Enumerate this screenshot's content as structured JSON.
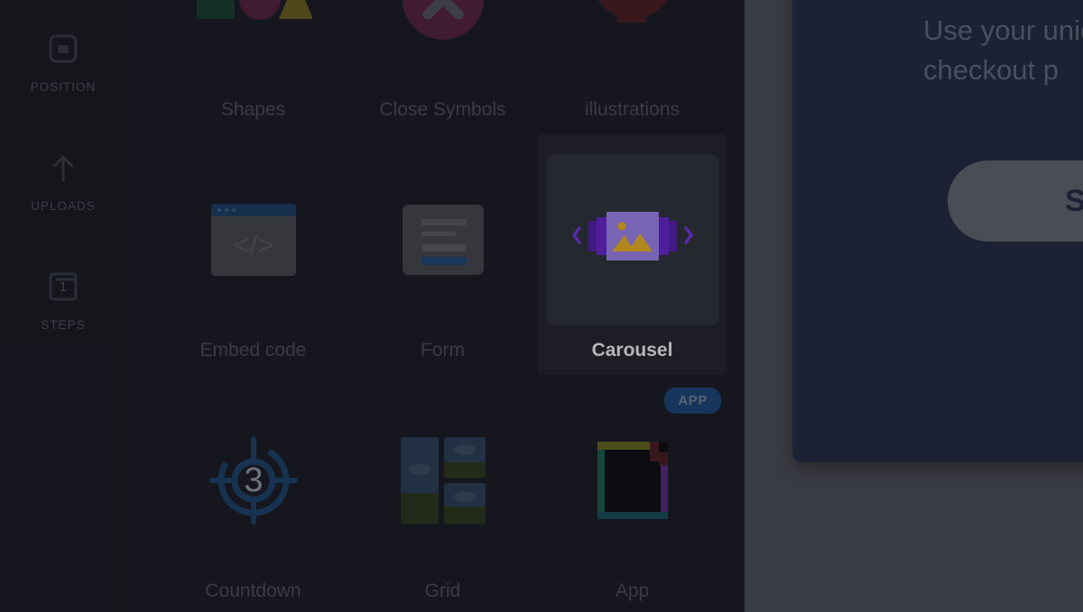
{
  "sidebar": {
    "items": [
      {
        "label": "POSITION",
        "icon": "position-icon"
      },
      {
        "label": "UPLOADS",
        "icon": "upload-arrow-icon"
      },
      {
        "label": "STEPS",
        "icon": "steps-icon",
        "badge": "1"
      }
    ]
  },
  "elements_panel": {
    "items": [
      {
        "label": "Shapes",
        "icon": "shapes-icon",
        "selected": false
      },
      {
        "label": "Close Symbols",
        "icon": "close-symbol-icon",
        "selected": false
      },
      {
        "label": "illustrations",
        "icon": "noodle-bowl-icon",
        "selected": false
      },
      {
        "label": "Embed code",
        "icon": "embed-code-icon",
        "selected": false
      },
      {
        "label": "Form",
        "icon": "form-icon",
        "selected": false
      },
      {
        "label": "Carousel",
        "icon": "carousel-icon",
        "selected": true
      },
      {
        "label": "Countdown",
        "icon": "countdown-icon",
        "selected": false
      },
      {
        "label": "Grid",
        "icon": "image-grid-icon",
        "selected": false
      },
      {
        "label": "App",
        "icon": "app-document-icon",
        "selected": false,
        "badge": "APP"
      }
    ]
  },
  "canvas": {
    "promo": {
      "text": "Use your unique\ncheckout p",
      "button_label": "Shop"
    }
  },
  "colors": {
    "rail_bg": "#1a1b22",
    "panel_bg": "#1c1d25",
    "canvas_bg": "#3a3c43",
    "selected_card_bg": "#26282f",
    "selected_thumb_bg": "#32353d",
    "promo_bg": "#1c2134",
    "promo_button_bg": "#4a4d55",
    "label_muted": "#4f525c",
    "label_active": "#ffffff",
    "carousel_purple": "#8b5cf6",
    "carousel_purple_dark": "#6d28d9",
    "carousel_yellow": "#fbbf24",
    "app_badge_bg": "#1c4a80"
  }
}
